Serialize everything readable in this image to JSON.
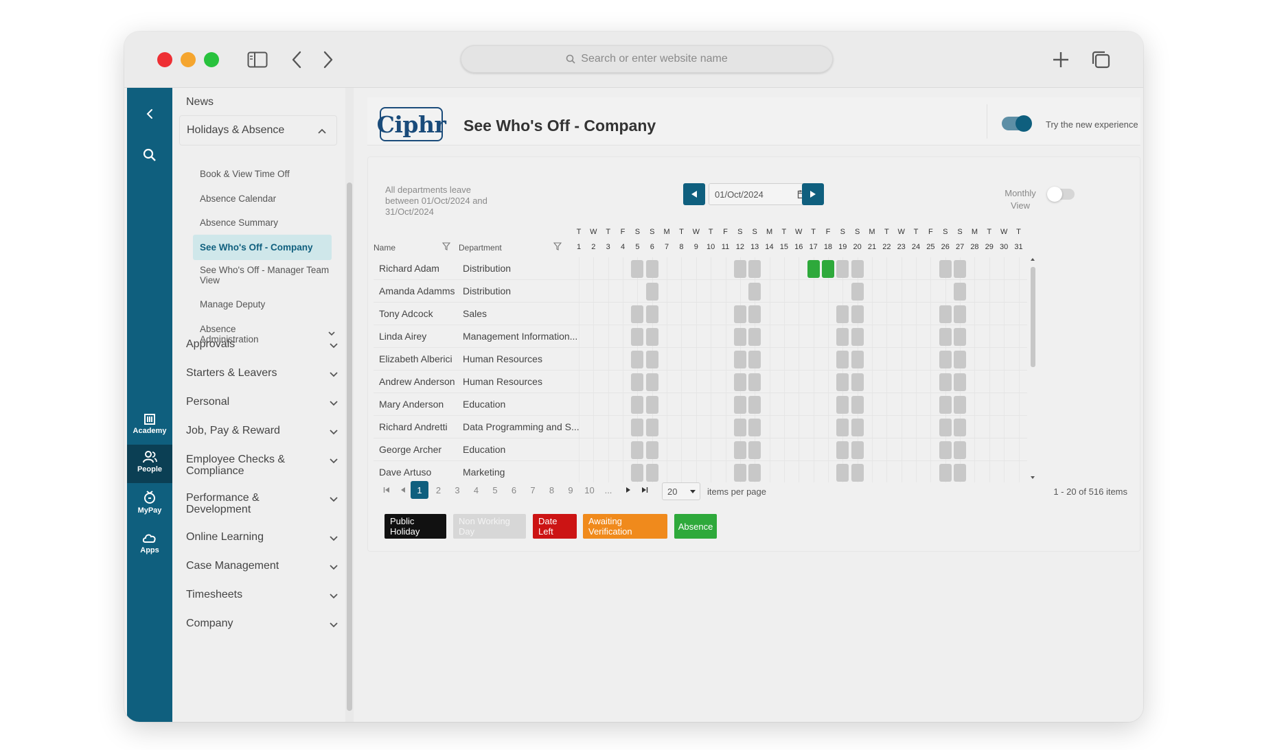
{
  "browser": {
    "address_placeholder": "Search or enter website name"
  },
  "rail": {
    "items": [
      {
        "label": "Academy"
      },
      {
        "label": "People"
      },
      {
        "label": "MyPay"
      },
      {
        "label": "Apps"
      }
    ]
  },
  "nav": {
    "news": "News",
    "holidays": "Holidays & Absence",
    "sub_items": [
      "Book & View Time Off",
      "Absence Calendar",
      "Absence Summary",
      "See Who's Off - Company",
      "See Who's Off - Manager Team View",
      "Manage Deputy",
      "Absence Administration"
    ],
    "sections": [
      "Approvals",
      "Starters & Leavers",
      "Personal",
      "Job, Pay & Reward",
      "Employee Checks & Compliance",
      "Performance & Development",
      "Online Learning",
      "Case Management",
      "Timesheets",
      "Company"
    ]
  },
  "header": {
    "logo": "Ciphr",
    "title": "See Who's Off - Company",
    "toggle_label": "Try the new experience"
  },
  "calendar": {
    "summary": "All departments leave between 01/Oct/2024 and 31/Oct/2024",
    "date_value": "01/Oct/2024",
    "monthly_label": "Monthly View",
    "col_name": "Name",
    "col_dept": "Department",
    "day_letters": [
      "T",
      "W",
      "T",
      "F",
      "S",
      "S",
      "M",
      "T",
      "W",
      "T",
      "F",
      "S",
      "S",
      "M",
      "T",
      "W",
      "T",
      "F",
      "S",
      "S",
      "M",
      "T",
      "W",
      "T",
      "F",
      "S",
      "S",
      "M",
      "T",
      "W",
      "T"
    ],
    "day_numbers": [
      "1",
      "2",
      "3",
      "4",
      "5",
      "6",
      "7",
      "8",
      "9",
      "10",
      "11",
      "12",
      "13",
      "14",
      "15",
      "16",
      "17",
      "18",
      "19",
      "20",
      "21",
      "22",
      "23",
      "24",
      "25",
      "26",
      "27",
      "28",
      "29",
      "30",
      "31"
    ],
    "rows": [
      {
        "name": "Richard Adam",
        "dept": "Distribution",
        "absence_days": [
          17,
          18
        ]
      },
      {
        "name": "Amanda Adamms",
        "dept": "Distribution",
        "absence_days": []
      },
      {
        "name": "Tony Adcock",
        "dept": "Sales",
        "absence_days": []
      },
      {
        "name": "Linda Airey",
        "dept": "Management Information...",
        "absence_days": []
      },
      {
        "name": "Elizabeth Alberici",
        "dept": "Human Resources",
        "absence_days": []
      },
      {
        "name": "Andrew Anderson",
        "dept": "Human Resources",
        "absence_days": []
      },
      {
        "name": "Mary Anderson",
        "dept": "Education",
        "absence_days": []
      },
      {
        "name": "Richard Andretti",
        "dept": "Data Programming and S...",
        "absence_days": []
      },
      {
        "name": "George Archer",
        "dept": "Education",
        "absence_days": []
      },
      {
        "name": "Dave Artuso",
        "dept": "Marketing",
        "absence_days": []
      }
    ],
    "pages": [
      "1",
      "2",
      "3",
      "4",
      "5",
      "6",
      "7",
      "8",
      "9",
      "10",
      "..."
    ],
    "active_page": "1",
    "per_page": "20",
    "per_page_label": "items per page",
    "range": "1 - 20 of 516 items"
  },
  "legend": [
    {
      "label": "Public Holiday",
      "color": "#111111"
    },
    {
      "label": "Non Working Day",
      "color": "#d7d7d7"
    },
    {
      "label": "Date Left",
      "color": "#cc1414"
    },
    {
      "label": "Awaiting Verification",
      "color": "#f08a1c"
    },
    {
      "label": "Absence",
      "color": "#2ea93b"
    }
  ],
  "colors": {
    "brand": "#0f5f7e",
    "weekend_block": "#c8c8c8",
    "absence": "#2ea93b"
  }
}
